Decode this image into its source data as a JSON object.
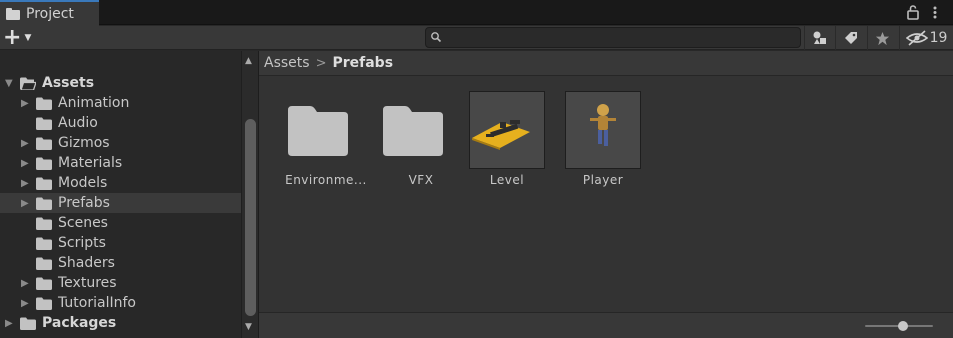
{
  "window": {
    "tab_label": "Project"
  },
  "toolbar": {
    "add_label": "+",
    "search": {
      "placeholder": "",
      "value": ""
    },
    "hidden_count": "19"
  },
  "tree": {
    "assets": {
      "label": "Assets",
      "children": [
        {
          "label": "Animation",
          "has_children": true
        },
        {
          "label": "Audio",
          "has_children": false
        },
        {
          "label": "Gizmos",
          "has_children": true
        },
        {
          "label": "Materials",
          "has_children": true
        },
        {
          "label": "Models",
          "has_children": true
        },
        {
          "label": "Prefabs",
          "has_children": true,
          "selected": true
        },
        {
          "label": "Scenes",
          "has_children": false
        },
        {
          "label": "Scripts",
          "has_children": false
        },
        {
          "label": "Shaders",
          "has_children": false
        },
        {
          "label": "Textures",
          "has_children": true
        },
        {
          "label": "TutorialInfo",
          "has_children": true
        }
      ]
    },
    "packages": {
      "label": "Packages"
    }
  },
  "breadcrumb": {
    "root": "Assets",
    "separator": ">",
    "current": "Prefabs"
  },
  "items": [
    {
      "label": "Environme...",
      "kind": "folder"
    },
    {
      "label": "VFX",
      "kind": "folder"
    },
    {
      "label": "Level",
      "kind": "prefab"
    },
    {
      "label": "Player",
      "kind": "prefab"
    }
  ],
  "colors": {
    "accent": "#3a79bb",
    "background": "#282828",
    "panel": "#383838",
    "selected_row": "#3a3a3a",
    "folder_icon": "#c2c2c2",
    "level_floor": "#e6b01e",
    "player_body": "#d0a24a"
  }
}
